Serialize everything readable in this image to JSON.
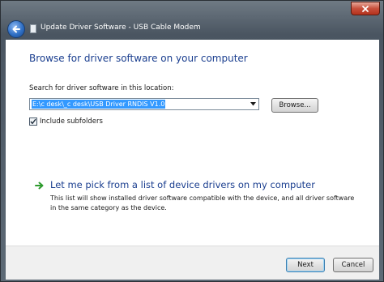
{
  "window": {
    "title": "Update Driver Software - USB Cable Modem"
  },
  "main": {
    "heading": "Browse for driver software on your computer",
    "search_label": "Search for driver software in this location:",
    "path_value": "E:\\c desk\\_c desk\\USB Driver RNDIS V1.0",
    "browse_label": "Browse...",
    "include_subfolders_label": "Include subfolders",
    "include_subfolders_checked": true,
    "pick_link": "Let me pick from a list of device drivers on my computer",
    "pick_description": "This list will show installed driver software compatible with the device, and all driver software in the same category as the device."
  },
  "footer": {
    "next_label": "Next",
    "cancel_label": "Cancel"
  },
  "colors": {
    "heading": "#1a3e8f",
    "link": "#1a3e8f",
    "selection": "#3399ff",
    "close_button": "#c7503c"
  },
  "icons": [
    "close-icon",
    "back-arrow-icon",
    "window-icon",
    "dropdown-arrow-icon",
    "checkmark-icon",
    "green-arrow-icon"
  ]
}
